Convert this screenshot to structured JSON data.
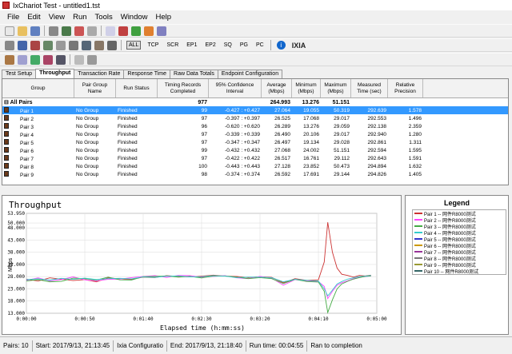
{
  "window": {
    "title": "IxChariot Test - untitled1.tst"
  },
  "menu": [
    "File",
    "Edit",
    "View",
    "Run",
    "Tools",
    "Window",
    "Help"
  ],
  "toolbar": {
    "protocols": [
      "ALL",
      "TCP",
      "SCR",
      "EP1",
      "EP2",
      "SQ",
      "PG",
      "PC"
    ],
    "brand": "IXIA"
  },
  "tabs": [
    "Test Setup",
    "Throughput",
    "Transaction Rate",
    "Response Time",
    "Raw Data Totals",
    "Endpoint Configuration"
  ],
  "table": {
    "headers": [
      "Group",
      "Pair Group Name",
      "Run Status",
      "Timing Records Completed",
      "95% Confidence Interval",
      "Average (Mbps)",
      "Minimum (Mbps)",
      "Maximum (Mbps)",
      "Measured Time (sec)",
      "Relative Precision"
    ],
    "all_pairs": {
      "label": "All Pairs",
      "records": "977",
      "avg": "264.993",
      "min": "13.276",
      "max": "51.151"
    },
    "rows": [
      {
        "pair": "Pair 1",
        "group": "No Group",
        "status": "Finished",
        "records": "99",
        "ci": "-0.427 : +0.427",
        "avg": "27.064",
        "min": "19.055",
        "max": "50.319",
        "time": "292.639",
        "prec": "1.578"
      },
      {
        "pair": "Pair 2",
        "group": "No Group",
        "status": "Finished",
        "records": "97",
        "ci": "-0.397 : +0.397",
        "avg": "26.525",
        "min": "17.068",
        "max": "29.017",
        "time": "292.553",
        "prec": "1.496"
      },
      {
        "pair": "Pair 3",
        "group": "No Group",
        "status": "Finished",
        "records": "96",
        "ci": "-0.620 : +0.620",
        "avg": "26.289",
        "min": "13.276",
        "max": "29.059",
        "time": "292.138",
        "prec": "2.359"
      },
      {
        "pair": "Pair 4",
        "group": "No Group",
        "status": "Finished",
        "records": "97",
        "ci": "-0.339 : +0.339",
        "avg": "26.490",
        "min": "20.106",
        "max": "29.017",
        "time": "292.940",
        "prec": "1.280"
      },
      {
        "pair": "Pair 5",
        "group": "No Group",
        "status": "Finished",
        "records": "97",
        "ci": "-0.347 : +0.347",
        "avg": "26.497",
        "min": "19.134",
        "max": "29.028",
        "time": "292.861",
        "prec": "1.311"
      },
      {
        "pair": "Pair 6",
        "group": "No Group",
        "status": "Finished",
        "records": "99",
        "ci": "-0.432 : +0.432",
        "avg": "27.068",
        "min": "24.002",
        "max": "51.151",
        "time": "292.594",
        "prec": "1.595"
      },
      {
        "pair": "Pair 7",
        "group": "No Group",
        "status": "Finished",
        "records": "97",
        "ci": "-0.422 : +0.422",
        "avg": "26.517",
        "min": "16.761",
        "max": "29.112",
        "time": "292.643",
        "prec": "1.591"
      },
      {
        "pair": "Pair 8",
        "group": "No Group",
        "status": "Finished",
        "records": "100",
        "ci": "-0.443 : +0.443",
        "avg": "27.128",
        "min": "23.852",
        "max": "50.473",
        "time": "294.894",
        "prec": "1.632"
      },
      {
        "pair": "Pair 9",
        "group": "No Group",
        "status": "Finished",
        "records": "98",
        "ci": "-0.374 : +0.374",
        "avg": "26.592",
        "min": "17.691",
        "max": "29.144",
        "time": "294.826",
        "prec": "1.405"
      }
    ]
  },
  "legend": {
    "title": "Legend",
    "items": [
      "Pair 1 -- 网件R8000测试",
      "Pair 2 -- 网件R8000测试",
      "Pair 3 -- 网件R8000测试",
      "Pair 4 -- 网件R8000测试",
      "Pair 5 -- 网件R8000测试",
      "Pair 6 -- 网件R8000测试",
      "Pair 7 -- 网件R8000测试",
      "Pair 8 -- 网件R8000测试",
      "Pair 9 -- 网件R8000测试",
      "Pair 10 -- 网件R8000测试"
    ],
    "colors": [
      "#cc3333",
      "#ff44ff",
      "#44aa44",
      "#33cccc",
      "#3333cc",
      "#cc9900",
      "#993399",
      "#777777",
      "#999933",
      "#336666"
    ]
  },
  "chart_data": {
    "type": "line",
    "title": "Throughput",
    "xlabel": "Elapsed time (h:mm:ss)",
    "ylabel": "Mbps",
    "ylim": [
      13.0,
      53.95
    ],
    "yticks": [
      "53.950",
      "50.000",
      "48.000",
      "43.000",
      "38.000",
      "33.000",
      "28.000",
      "23.000",
      "18.000",
      "13.000"
    ],
    "xticks": [
      "0:00:00",
      "0:00:50",
      "0:01:40",
      "0:02:30",
      "0:03:20",
      "0:04:10",
      "0:05:00"
    ],
    "xlim": [
      0,
      300
    ],
    "x": [
      0,
      10,
      20,
      30,
      40,
      50,
      60,
      70,
      80,
      90,
      100,
      110,
      120,
      130,
      140,
      150,
      160,
      170,
      180,
      190,
      200,
      210,
      220,
      230,
      240,
      250,
      255,
      258,
      262,
      266,
      270,
      275,
      280,
      285,
      290,
      295
    ],
    "series": [
      {
        "values": [
          27,
          26.2,
          27.5,
          27,
          26.4,
          26.8,
          25.9,
          27.5,
          27.1,
          26.9,
          27.8,
          27.6,
          28.4,
          28.1,
          27.9,
          28.2,
          28.6,
          28.2,
          28.1,
          27.6,
          28,
          27.7,
          25.5,
          27.2,
          26.5,
          26.7,
          34,
          50.3,
          38,
          31.5,
          29,
          28.5,
          27.8,
          28.5,
          28.3,
          28.6
        ]
      },
      {
        "values": [
          26.5,
          27.5,
          26.3,
          26.8,
          27.9,
          26.7,
          26.3,
          26.9,
          27,
          27.6,
          28.1,
          28.4,
          27.7,
          28.5,
          28.4,
          27.7,
          28.1,
          28.4,
          27.5,
          27.2,
          28.1,
          27.4,
          24.5,
          26.8,
          26.2,
          26,
          24,
          19,
          22,
          24.5,
          25.5,
          26.3,
          27.2,
          27.8,
          28,
          28.3
        ]
      },
      {
        "values": [
          26.2,
          26.8,
          25.9,
          26.1,
          27.4,
          27.2,
          26.6,
          27.8,
          26.7,
          26.6,
          28,
          28.1,
          28.3,
          27.8,
          28.1,
          27.5,
          28.2,
          28.3,
          27.8,
          27.2,
          27.6,
          27.2,
          25.2,
          26.9,
          26,
          25.8,
          22,
          13.3,
          18.5,
          23,
          25,
          26.1,
          27,
          27.6,
          28.1,
          28.3
        ]
      },
      {
        "values": [
          26.8,
          27.1,
          26.6,
          27.3,
          26.9,
          27.4,
          26.8,
          27.2,
          27.3,
          27.1,
          27.9,
          27.7,
          28.2,
          28.3,
          27.9,
          28,
          28.4,
          28.2,
          27.6,
          27.8,
          27.8,
          27.6,
          25.9,
          26.9,
          26.5,
          26.2,
          23,
          20.1,
          22.5,
          25,
          26,
          27,
          27.5,
          28,
          28.2,
          28.5
        ]
      }
    ]
  },
  "status": {
    "pairs": "Pairs: 10",
    "start": "Start: 2017/9/13, 21:13:45",
    "config": "Ixia Configuratio",
    "end": "End: 2017/9/13, 21:18:40",
    "runtime": "Run time: 00:04:55",
    "result": "Ran to completion"
  }
}
